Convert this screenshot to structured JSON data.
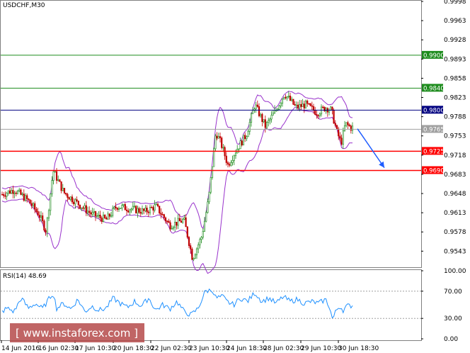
{
  "chart_data": [
    {
      "type": "candlestick",
      "title": "USDCHF,M30",
      "x_labels": [
        "14 Jun 2016",
        "16 Jun 02:30",
        "17 Jun 10:30",
        "20 Jun 18:30",
        "22 Jun 02:30",
        "23 Jun 10:30",
        "24 Jun 18:30",
        "28 Jun 02:30",
        "29 Jun 10:30",
        "30 Jun 18:30"
      ],
      "y_ticks": [
        "0.9998",
        "0.9963",
        "0.9928",
        "0.9893",
        "0.9858",
        "0.9823",
        "0.9788",
        "0.9753",
        "0.9718",
        "0.9683",
        "0.9648",
        "0.9613",
        "0.9578",
        "0.9543"
      ],
      "ylim": [
        0.9515,
        0.9998
      ],
      "price_path": [
        [
          0,
          0.9645
        ],
        [
          20,
          0.9655
        ],
        [
          40,
          0.9635
        ],
        [
          55,
          0.961
        ],
        [
          65,
          0.958
        ],
        [
          75,
          0.969
        ],
        [
          90,
          0.965
        ],
        [
          110,
          0.963
        ],
        [
          130,
          0.961
        ],
        [
          150,
          0.96
        ],
        [
          165,
          0.9625
        ],
        [
          185,
          0.962
        ],
        [
          205,
          0.9615
        ],
        [
          220,
          0.9625
        ],
        [
          240,
          0.959
        ],
        [
          260,
          0.96
        ],
        [
          272,
          0.953
        ],
        [
          285,
          0.957
        ],
        [
          295,
          0.964
        ],
        [
          305,
          0.976
        ],
        [
          312,
          0.974
        ],
        [
          322,
          0.97
        ],
        [
          335,
          0.973
        ],
        [
          348,
          0.9755
        ],
        [
          360,
          0.981
        ],
        [
          375,
          0.977
        ],
        [
          390,
          0.98
        ],
        [
          402,
          0.983
        ],
        [
          418,
          0.9805
        ],
        [
          432,
          0.981
        ],
        [
          448,
          0.9795
        ],
        [
          460,
          0.9805
        ],
        [
          468,
          0.98
        ],
        [
          476,
          0.976
        ],
        [
          482,
          0.974
        ],
        [
          488,
          0.9775
        ],
        [
          496,
          0.9768
        ]
      ],
      "levels": [
        {
          "value": 0.99,
          "label": "0.9900",
          "color": "#1e8c1e"
        },
        {
          "value": 0.984,
          "label": "0.9840",
          "color": "#1e8c1e"
        },
        {
          "value": 0.98,
          "label": "0.9800",
          "color": "#000080"
        },
        {
          "value": 0.9765,
          "label": "0.9765",
          "color": "#a0a0a0"
        },
        {
          "value": 0.9725,
          "label": "0.9725",
          "color": "#ff0000"
        },
        {
          "value": 0.969,
          "label": "0.9690",
          "color": "#ff0000"
        }
      ],
      "forecast_arrow": {
        "color": "#1e5cff",
        "from": [
          505,
          0.9766
        ],
        "to": [
          543,
          0.9695
        ]
      },
      "colors": {
        "bull": "#1e8c1e",
        "bear": "#c00000",
        "bands": "#9932cc",
        "frame": "#808080"
      }
    },
    {
      "type": "line",
      "title": "RSI(14) 48.69",
      "y_ticks": [
        "100.00",
        "70.00",
        "30.00",
        "0.00"
      ],
      "ylim": [
        0,
        100
      ],
      "levels": [
        70,
        30
      ],
      "series": [
        {
          "color": "#1e90ff",
          "values": [
            [
              0,
              38
            ],
            [
              10,
              45
            ],
            [
              20,
              40
            ],
            [
              30,
              60
            ],
            [
              40,
              45
            ],
            [
              50,
              52
            ],
            [
              60,
              44
            ],
            [
              70,
              60
            ],
            [
              75,
              68
            ],
            [
              80,
              45
            ],
            [
              90,
              52
            ],
            [
              100,
              44
            ],
            [
              110,
              58
            ],
            [
              120,
              40
            ],
            [
              130,
              48
            ],
            [
              140,
              42
            ],
            [
              150,
              45
            ],
            [
              160,
              60
            ],
            [
              170,
              52
            ],
            [
              180,
              46
            ],
            [
              190,
              55
            ],
            [
              200,
              48
            ],
            [
              210,
              60
            ],
            [
              220,
              42
            ],
            [
              230,
              50
            ],
            [
              240,
              44
            ],
            [
              250,
              55
            ],
            [
              260,
              40
            ],
            [
              270,
              35
            ],
            [
              280,
              45
            ],
            [
              290,
              70
            ],
            [
              300,
              72
            ],
            [
              305,
              60
            ],
            [
              315,
              62
            ],
            [
              320,
              55
            ],
            [
              330,
              50
            ],
            [
              340,
              60
            ],
            [
              350,
              55
            ],
            [
              360,
              68
            ],
            [
              370,
              55
            ],
            [
              380,
              60
            ],
            [
              390,
              52
            ],
            [
              400,
              62
            ],
            [
              410,
              55
            ],
            [
              420,
              58
            ],
            [
              430,
              52
            ],
            [
              440,
              55
            ],
            [
              450,
              52
            ],
            [
              460,
              58
            ],
            [
              465,
              48
            ],
            [
              470,
              28
            ],
            [
              475,
              42
            ],
            [
              480,
              48
            ],
            [
              485,
              42
            ],
            [
              490,
              48
            ],
            [
              498,
              49
            ]
          ]
        }
      ]
    }
  ],
  "watermark": "[ www.instaforex.com ]"
}
